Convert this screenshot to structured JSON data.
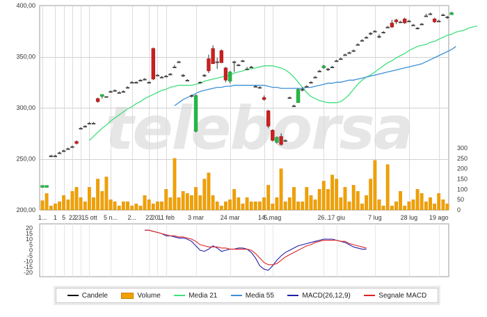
{
  "watermark": "teleborsa",
  "legend": [
    {
      "label": "Candele",
      "color": "#000000",
      "kind": "line"
    },
    {
      "label": "Volume",
      "color": "#f0a000",
      "kind": "box"
    },
    {
      "label": "Media 21",
      "color": "#3ee07a",
      "kind": "line"
    },
    {
      "label": "Media 55",
      "color": "#3a8fd8",
      "kind": "line"
    },
    {
      "label": "MACD(26,12,9)",
      "color": "#1e1ea8",
      "kind": "line"
    },
    {
      "label": "Segnale MACD",
      "color": "#dd2222",
      "kind": "line"
    }
  ],
  "chart_data": [
    {
      "type": "candlestick",
      "ylim": [
        200,
        400
      ],
      "yticks": [
        "200,00",
        "250,00",
        "300,00",
        "350,00",
        "400,00"
      ],
      "xticks": [
        {
          "i": 0,
          "label": "1..."
        },
        {
          "i": 3,
          "label": "1"
        },
        {
          "i": 5,
          "label": "5"
        },
        {
          "i": 7,
          "label": "22"
        },
        {
          "i": 9,
          "label": "23..."
        },
        {
          "i": 11,
          "label": "15 ott"
        },
        {
          "i": 16,
          "label": "5 n..."
        },
        {
          "i": 21,
          "label": "2..."
        },
        {
          "i": 25,
          "label": "22"
        },
        {
          "i": 27,
          "label": "20..."
        },
        {
          "i": 29,
          "label": "11 feb"
        },
        {
          "i": 36,
          "label": "3 mar"
        },
        {
          "i": 44,
          "label": "24 mar"
        },
        {
          "i": 52,
          "label": "14..."
        },
        {
          "i": 54,
          "label": "5 mag"
        },
        {
          "i": 66,
          "label": "26..."
        },
        {
          "i": 69,
          "label": "17 giu"
        },
        {
          "i": 78,
          "label": "7 lug"
        },
        {
          "i": 86,
          "label": "28 lug"
        },
        {
          "i": 93,
          "label": "19 ago"
        }
      ],
      "candles": [
        [
          222,
          223,
          224,
          224
        ],
        [
          222,
          223,
          224,
          224
        ],
        [
          253,
          252,
          254,
          253
        ],
        [
          253,
          252,
          254,
          253
        ],
        [
          256,
          255,
          257,
          256
        ],
        [
          258,
          257,
          259,
          258
        ],
        [
          260,
          259,
          261,
          260
        ],
        [
          262,
          261,
          263,
          262
        ],
        [
          267,
          264,
          268,
          265
        ],
        [
          280,
          279,
          281,
          280
        ],
        [
          282,
          281,
          283,
          282
        ],
        [
          285,
          284,
          286,
          285
        ],
        [
          285,
          284,
          286,
          285
        ],
        [
          309,
          305,
          310,
          306
        ],
        [
          311,
          309,
          313,
          313
        ],
        [
          310,
          310,
          311,
          311
        ],
        [
          316,
          315,
          317,
          316
        ],
        [
          317,
          316,
          318,
          317
        ],
        [
          315,
          314,
          316,
          315
        ],
        [
          316,
          315,
          317,
          316
        ],
        [
          320,
          319,
          321,
          320
        ],
        [
          325,
          324,
          326,
          325
        ],
        [
          325,
          324,
          326,
          325
        ],
        [
          327,
          326,
          328,
          327
        ],
        [
          328,
          327,
          329,
          328
        ],
        [
          325,
          324,
          326,
          325
        ],
        [
          358,
          327,
          359,
          328
        ],
        [
          332,
          331,
          333,
          332
        ],
        [
          330,
          329,
          331,
          330
        ],
        [
          331,
          330,
          332,
          331
        ],
        [
          333,
          332,
          334,
          333
        ],
        [
          340,
          339,
          342,
          340
        ],
        [
          345,
          344,
          346,
          345
        ],
        [
          332,
          330,
          333,
          331
        ],
        [
          327,
          326,
          328,
          327
        ],
        [
          312,
          310,
          313,
          311
        ],
        [
          277,
          276,
          313,
          312
        ],
        [
          325,
          324,
          326,
          325
        ],
        [
          332,
          330,
          333,
          331
        ],
        [
          348,
          334,
          352,
          336
        ],
        [
          358,
          343,
          361,
          343
        ],
        [
          345,
          338,
          349,
          345
        ],
        [
          356,
          344,
          357,
          344
        ],
        [
          339,
          325,
          340,
          327
        ],
        [
          326,
          324,
          336,
          335
        ],
        [
          344,
          335,
          346,
          345
        ],
        [
          342,
          341,
          343,
          342
        ],
        [
          346,
          345,
          347,
          346
        ],
        [
          338,
          337,
          340,
          338
        ],
        [
          340,
          339,
          341,
          340
        ],
        [
          321,
          320,
          322,
          321
        ],
        [
          320,
          319,
          321,
          320
        ],
        [
          310,
          307,
          312,
          308
        ],
        [
          297,
          280,
          298,
          282
        ],
        [
          278,
          267,
          279,
          268
        ],
        [
          266,
          265,
          272,
          271
        ],
        [
          272,
          263,
          275,
          264
        ],
        [
          268,
          267,
          269,
          268
        ],
        [
          310,
          309,
          311,
          310
        ],
        [
          302,
          301,
          303,
          302
        ],
        [
          305,
          318,
          319,
          318
        ],
        [
          318,
          316,
          320,
          317
        ],
        [
          321,
          320,
          322,
          321
        ],
        [
          325,
          324,
          326,
          325
        ],
        [
          330,
          329,
          331,
          330
        ],
        [
          336,
          335,
          337,
          336
        ],
        [
          339,
          338,
          342,
          341
        ],
        [
          338,
          336,
          339,
          337
        ],
        [
          340,
          339,
          341,
          340
        ],
        [
          346,
          345,
          347,
          346
        ],
        [
          348,
          347,
          349,
          348
        ],
        [
          352,
          351,
          353,
          352
        ],
        [
          354,
          353,
          355,
          354
        ],
        [
          356,
          355,
          357,
          356
        ],
        [
          362,
          361,
          363,
          362
        ],
        [
          366,
          365,
          367,
          366
        ],
        [
          369,
          368,
          370,
          369
        ],
        [
          372,
          371,
          374,
          373
        ],
        [
          375,
          374,
          376,
          375
        ],
        [
          370,
          368,
          372,
          369
        ],
        [
          374,
          373,
          375,
          374
        ],
        [
          379,
          378,
          380,
          379
        ],
        [
          383,
          378,
          386,
          379
        ],
        [
          386,
          382,
          387,
          384
        ],
        [
          384,
          383,
          385,
          384
        ],
        [
          387,
          382,
          388,
          383
        ],
        [
          385,
          384,
          386,
          385
        ],
        [
          381,
          380,
          382,
          381
        ],
        [
          378,
          377,
          379,
          378
        ],
        [
          382,
          381,
          383,
          382
        ],
        [
          390,
          389,
          392,
          390
        ],
        [
          392,
          391,
          393,
          392
        ],
        [
          387,
          383,
          388,
          384
        ],
        [
          385,
          384,
          386,
          385
        ],
        [
          391,
          390,
          392,
          391
        ],
        [
          388,
          387,
          390,
          389
        ],
        [
          391,
          392,
          394,
          393
        ]
      ],
      "candles_note": "each candle is [open, low, high, close]"
    },
    {
      "type": "line",
      "series": [
        {
          "name": "Media 21",
          "color": "#3ee07a",
          "start": 11,
          "values": [
            268,
            272,
            276,
            280,
            283,
            287,
            290,
            293,
            296,
            299,
            301,
            304,
            306,
            309,
            311,
            313,
            315,
            317,
            318,
            320,
            321,
            322,
            322,
            322,
            322,
            323,
            324,
            326,
            327,
            328,
            329,
            330,
            331,
            332,
            334,
            335,
            336,
            338,
            338,
            339,
            340,
            341,
            341,
            341,
            340,
            339,
            337,
            334,
            330,
            325,
            320,
            315,
            311,
            309,
            307,
            306,
            305,
            305,
            305,
            306,
            309,
            313,
            318,
            323,
            327,
            330,
            332,
            335,
            338,
            341,
            344,
            346,
            349,
            351,
            353,
            356,
            358,
            360,
            361,
            362,
            364,
            365,
            367,
            369,
            371,
            372,
            374,
            375,
            376,
            378,
            379,
            380
          ]
        },
        {
          "name": "Media 55",
          "color": "#3a8fd8",
          "start": 31,
          "values": [
            302,
            305,
            308,
            310,
            312,
            314,
            316,
            317,
            318,
            319,
            320,
            320,
            321,
            321,
            322,
            322,
            322,
            322,
            322,
            322,
            322,
            322,
            321,
            320,
            320,
            319,
            319,
            319,
            319,
            319,
            319,
            320,
            320,
            321,
            322,
            323,
            324,
            324,
            325,
            325,
            326,
            327,
            327,
            328,
            329,
            330,
            331,
            332,
            333,
            334,
            335,
            336,
            337,
            338,
            339,
            340,
            341,
            342,
            343,
            345,
            347,
            349,
            351,
            353,
            355,
            357,
            360
          ]
        }
      ]
    },
    {
      "type": "bar",
      "name": "Volume",
      "color": "#f0a000",
      "ylim": [
        0,
        300
      ],
      "yticks": [
        "0",
        "50",
        "100",
        "150",
        "200",
        "250",
        "300"
      ],
      "values": [
        45,
        80,
        20,
        30,
        40,
        70,
        50,
        90,
        110,
        60,
        40,
        110,
        60,
        150,
        90,
        160,
        50,
        40,
        20,
        40,
        40,
        20,
        30,
        20,
        70,
        50,
        30,
        40,
        40,
        100,
        60,
        250,
        60,
        90,
        80,
        70,
        110,
        70,
        150,
        180,
        70,
        40,
        20,
        40,
        50,
        100,
        60,
        30,
        60,
        40,
        40,
        40,
        60,
        120,
        30,
        60,
        200,
        40,
        60,
        110,
        40,
        40,
        110,
        70,
        50,
        100,
        140,
        100,
        170,
        150,
        60,
        110,
        40,
        120,
        90,
        30,
        70,
        150,
        240,
        50,
        20,
        220,
        20,
        40,
        90,
        20,
        40,
        50,
        100,
        80,
        40,
        60,
        30,
        80,
        50,
        30
      ]
    },
    {
      "type": "line",
      "name": "MACD",
      "ylim": [
        -20,
        20
      ],
      "yticks": [
        "20",
        "15",
        "10",
        "5",
        "0",
        "-5",
        "-10",
        "-15",
        "-20"
      ],
      "series": [
        {
          "name": "MACD(26,12,9)",
          "color": "#1e1ea8",
          "start": 24,
          "values": [
            18,
            18,
            17,
            16,
            15,
            13,
            13,
            12,
            11,
            11,
            10,
            8,
            4,
            0,
            -1,
            1,
            4,
            2,
            -1,
            0,
            1,
            1,
            2,
            2,
            1,
            -2,
            -7,
            -14,
            -17,
            -18,
            -14,
            -9,
            -5,
            -2,
            0,
            2,
            4,
            5,
            6,
            7,
            8,
            9,
            10,
            10,
            10,
            9,
            8,
            7,
            5,
            3,
            2,
            1,
            1
          ]
        },
        {
          "name": "Segnale MACD",
          "color": "#dd2222",
          "start": 24,
          "values": [
            18,
            18,
            17,
            16,
            15,
            14,
            13,
            13,
            12,
            12,
            11,
            10,
            8,
            5,
            4,
            3,
            3,
            3,
            2,
            2,
            1,
            1,
            1,
            1,
            1,
            0,
            -3,
            -7,
            -11,
            -13,
            -13,
            -12,
            -9,
            -6,
            -4,
            -2,
            0,
            2,
            4,
            5,
            7,
            8,
            9,
            9,
            9,
            9,
            8,
            8,
            6,
            5,
            4,
            3,
            2
          ]
        }
      ]
    }
  ]
}
